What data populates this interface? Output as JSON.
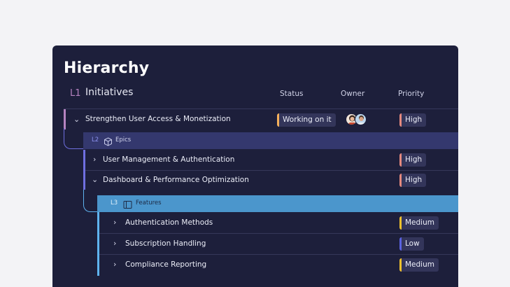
{
  "title": "Hierarchy",
  "header": {
    "level_tag": "L1",
    "level_label": "Initiatives",
    "columns": {
      "status": "Status",
      "owner": "Owner",
      "priority": "Priority"
    }
  },
  "initiative": {
    "label": "Strengthen User Access & Monetization",
    "status": "Working on it",
    "priority": "High",
    "owner_avatars": [
      "avatar-woman",
      "avatar-man"
    ]
  },
  "epics_band": {
    "level_tag": "L2",
    "label": "Epics",
    "icon": "box-icon"
  },
  "epics": [
    {
      "label": "User Management & Authentication",
      "priority": "High"
    },
    {
      "label": "Dashboard & Performance Optimization",
      "priority": "High"
    }
  ],
  "features_band": {
    "level_tag": "L3",
    "label": "Features",
    "icon": "sidebar-layout-icon"
  },
  "features": [
    {
      "label": "Authentication Methods",
      "priority": "Medium"
    },
    {
      "label": "Subscription Handling",
      "priority": "Low"
    },
    {
      "label": "Compliance Reporting",
      "priority": "Medium"
    }
  ],
  "colors": {
    "panel_bg": "#1d1f3b",
    "l1_accent": "#b583c0",
    "l2_band": "#34386e",
    "l2_accent": "#6f6fe0",
    "l3_band": "#4b96cc",
    "l3_accent": "#5fb3ef",
    "status_working": "#f5b05b",
    "priority_high": "#e58a7f",
    "priority_medium": "#f2c22d",
    "priority_low": "#5a62e0"
  }
}
